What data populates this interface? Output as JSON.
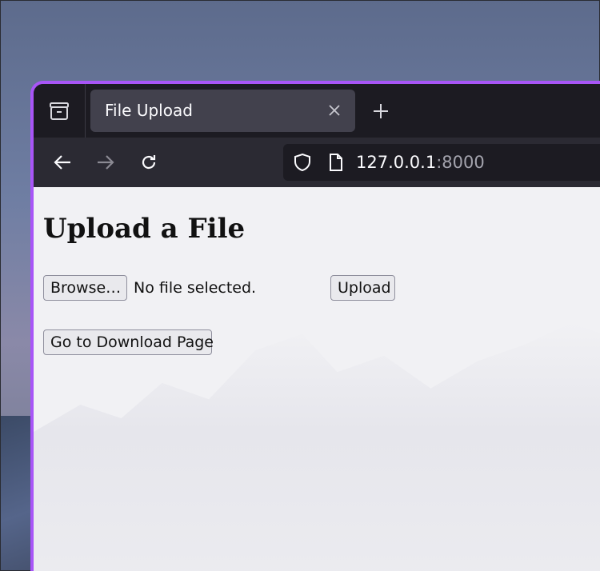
{
  "tab": {
    "title": "File Upload",
    "close_glyph": "×"
  },
  "new_tab_glyph": "+",
  "address_bar": {
    "host": "127.0.0.1",
    "port": ":8000"
  },
  "page": {
    "title": "Upload a File",
    "browse_label": "Browse…",
    "file_status": "No file selected.",
    "upload_label": "Upload",
    "download_link_label": "Go to Download Page"
  },
  "icons": {
    "tab_overview": "tab-overview-icon",
    "back": "back-arrow-icon",
    "forward": "forward-arrow-icon",
    "reload": "reload-icon",
    "shield": "shield-icon",
    "page": "page-icon"
  },
  "colors": {
    "window_accent": "#a855f7",
    "tabbar_bg": "#1c1b22",
    "toolbar_bg": "#2b2a33",
    "active_tab_bg": "#42414d",
    "content_bg": "#f1f1f4"
  }
}
